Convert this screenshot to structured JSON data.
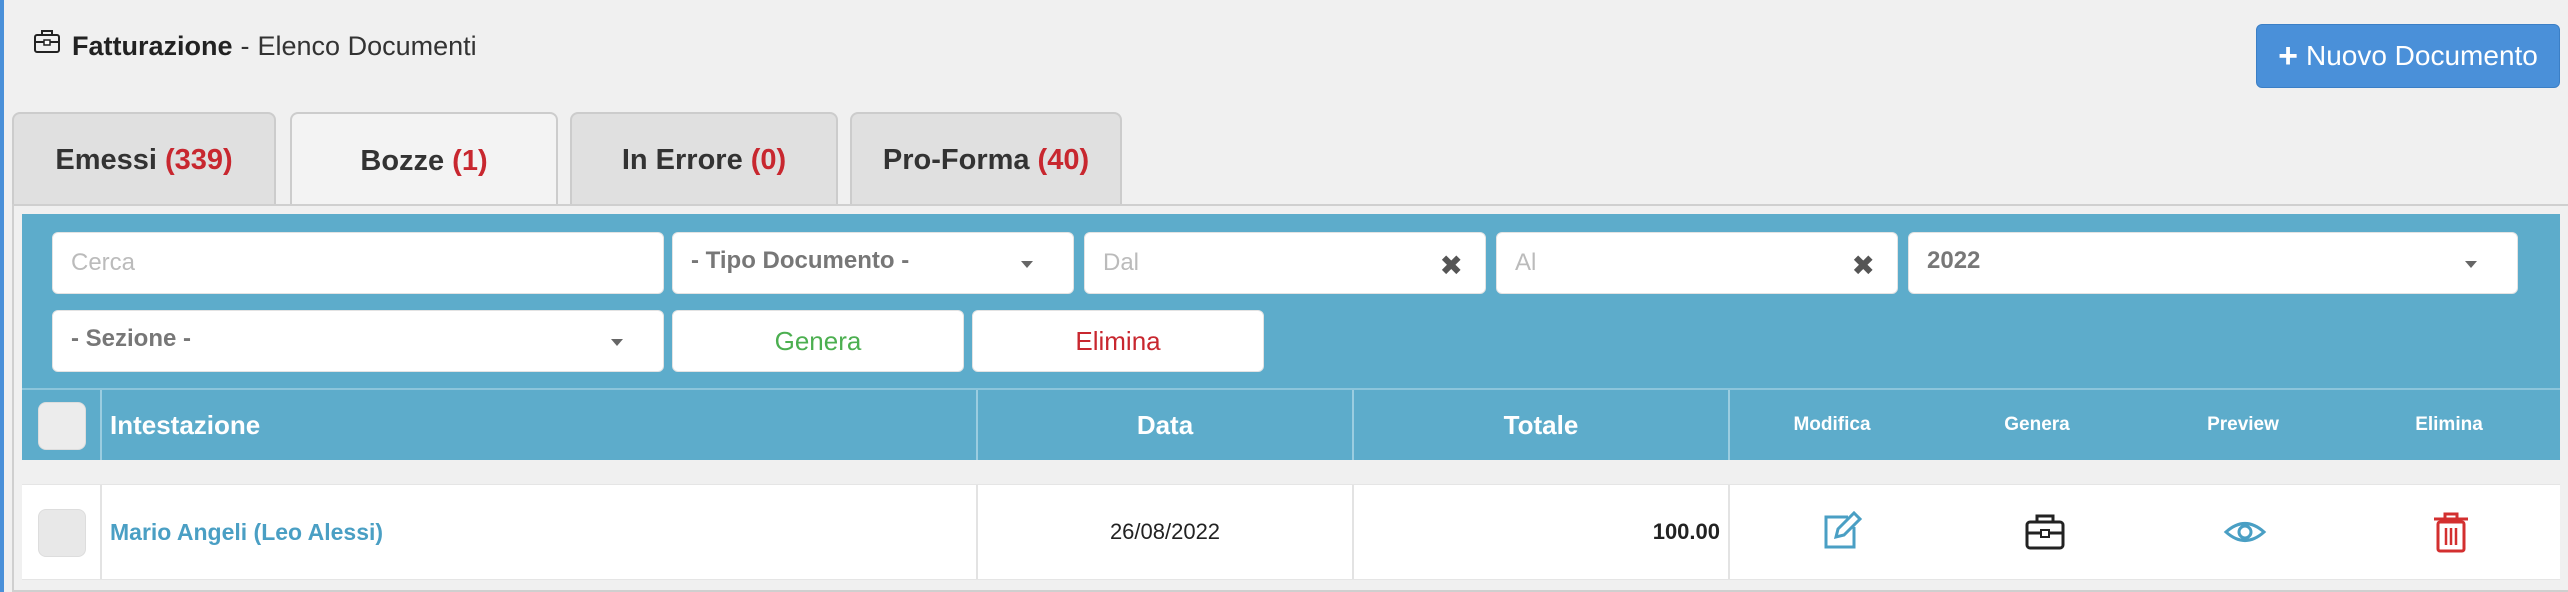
{
  "header": {
    "title": "Fatturazione",
    "separator": "-",
    "subtitle": "Elenco Documenti",
    "icon": "briefcase-icon"
  },
  "new_document_button": {
    "plus": "+",
    "label": "Nuovo Documento"
  },
  "tabs": [
    {
      "label": "Emessi",
      "count": "(339)"
    },
    {
      "label": "Bozze",
      "count": "(1)",
      "active": true
    },
    {
      "label": "In Errore",
      "count": "(0)"
    },
    {
      "label": "Pro-Forma",
      "count": "(40)"
    }
  ],
  "filters": {
    "search_placeholder": "Cerca",
    "document_type": "- Tipo Documento -",
    "from_placeholder": "Dal",
    "to_placeholder": "Al",
    "clear_symbol": "✖",
    "year": "2022",
    "section": "- Sezione -",
    "generate_label": "Genera",
    "delete_label": "Elimina"
  },
  "table": {
    "columns": {
      "heading": "Intestazione",
      "date": "Data",
      "total": "Totale",
      "edit": "Modifica",
      "generate": "Genera",
      "preview": "Preview",
      "delete": "Elimina"
    },
    "rows": [
      {
        "heading": "Mario Angeli (Leo Alessi)",
        "date": "26/08/2022",
        "total": "100.00"
      }
    ]
  },
  "colors": {
    "primary": "#4a90d9",
    "toolbar": "#5daccb",
    "count_red": "#c8272f",
    "generate_green": "#4caf50",
    "delete_red": "#c8272f",
    "link_blue": "#4a9fc4"
  }
}
